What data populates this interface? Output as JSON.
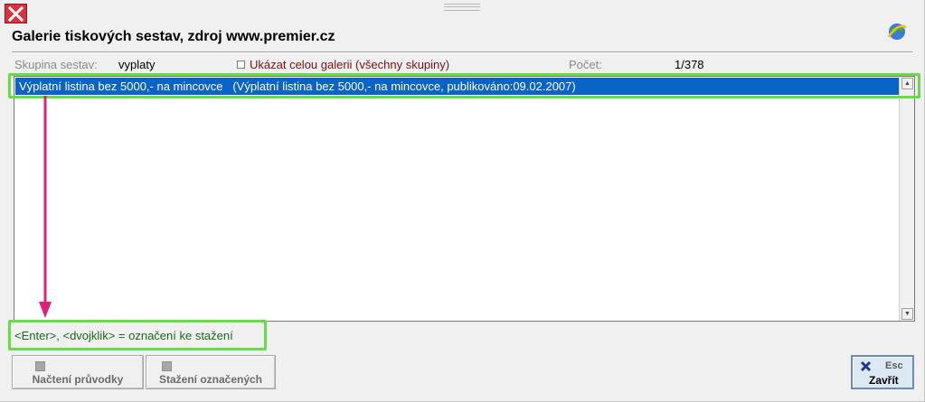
{
  "window": {
    "title": "Galerie tiskových sestav, zdroj www.premier.cz"
  },
  "filter": {
    "group_label": "Skupina sestav:",
    "group_value": "vyplaty",
    "show_all_label": "Ukázat celou galerii (všechny skupiny)",
    "show_all_checked": false,
    "count_label": "Počet:",
    "count_value": "1/378"
  },
  "list": {
    "items": [
      {
        "name": "Výplatní listina bez 5000,- na mincovce",
        "detail": "(Výplatní listina bez 5000,- na mincovce, publikováno:09.02.2007)",
        "selected": true
      }
    ]
  },
  "hint": {
    "text": "<Enter>, <dvojklik> = označení ke stažení"
  },
  "buttons": {
    "load_label": "Načtení průvodky",
    "download_label": "Stažení označených",
    "close_key": "Esc",
    "close_label": "Zavřít"
  },
  "colors": {
    "selection": "#0a64c8",
    "highlight_frame": "#66dd44",
    "arrow": "#e0207a",
    "hint_text": "#1a6a1a"
  },
  "icons": {
    "window_close": "close-icon",
    "globe": "globe-icon",
    "close_button": "x-icon"
  }
}
